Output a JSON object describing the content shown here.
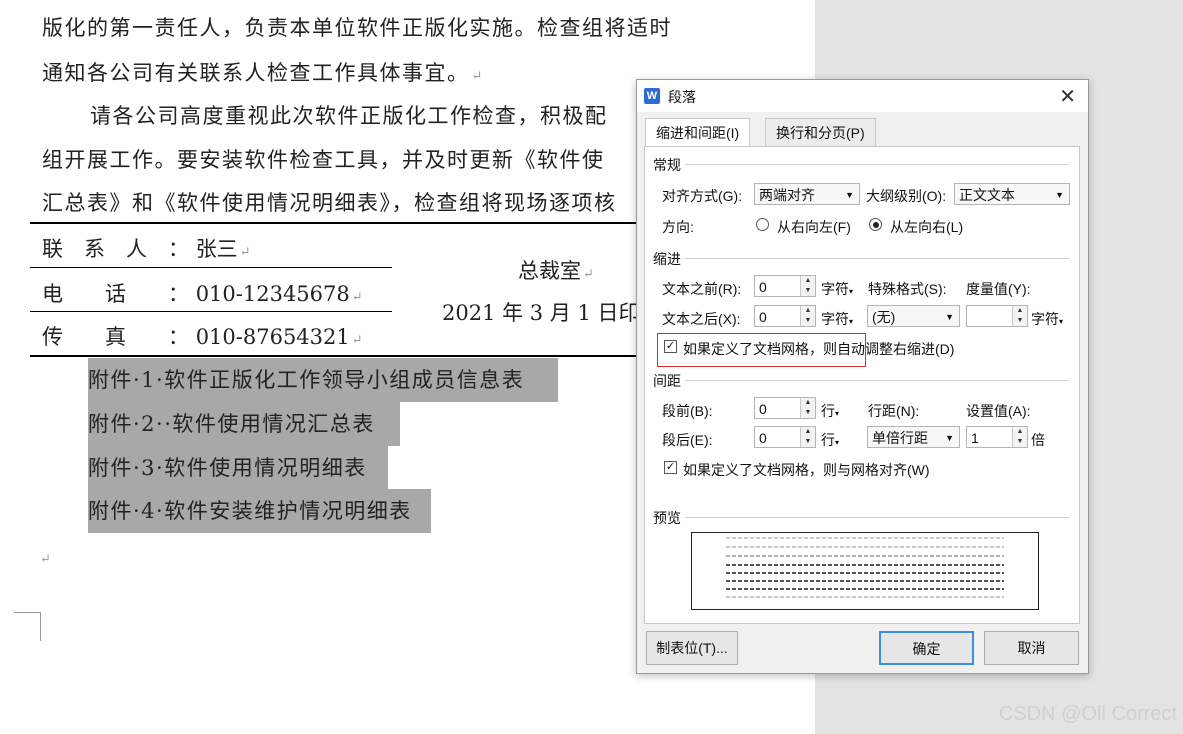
{
  "document": {
    "lines": [
      "版化的第一责任人，负责本单位软件正版化实施。检查组将适时",
      "通知各公司有关联系人检查工作具体事宜。",
      "请各公司高度重视此次软件正版化工作检查，积极配",
      "组开展工作。要安装软件检查工具，并及时更新《软件使",
      "汇总表》和《软件使用情况明细表》，检查组将现场逐项核"
    ],
    "contact": {
      "person_label": "联　系　人　：",
      "person_value": "张三",
      "phone_label": "电　　话　　：",
      "phone_value": "010-12345678",
      "fax_label": "传　　真　　：",
      "fax_value": "010-87654321"
    },
    "issuer": "总裁室",
    "date": "2021 年 3 月 1 日印",
    "attachments": [
      "附件·1·软件正版化工作领导小组成员信息表",
      "附件·2··软件使用情况汇总表",
      "附件·3·软件使用情况明细表",
      "附件·4·软件安装维护情况明细表"
    ],
    "paragraph_mark": "↵"
  },
  "dialog": {
    "title": "段落",
    "app_icon": "W",
    "close_glyph": "✕",
    "tabs": [
      "缩进和间距(I)",
      "换行和分页(P)"
    ],
    "general": {
      "section": "常规",
      "align_label": "对齐方式(G):",
      "align_value": "两端对齐",
      "outline_label": "大纲级别(O):",
      "outline_value": "正文文本",
      "direction_label": "方向:",
      "rtl_label": "从右向左(F)",
      "ltr_label": "从左向右(L)"
    },
    "indent": {
      "section": "缩进",
      "before_label": "文本之前(R):",
      "before_value": "0",
      "before_unit": "字符",
      "after_label": "文本之后(X):",
      "after_value": "0",
      "after_unit": "字符",
      "special_label": "特殊格式(S):",
      "special_value": "(无)",
      "measure_label": "度量值(Y):",
      "measure_value": "",
      "measure_unit": "字符",
      "grid_check": "如果定义了文档网格，则自动调整右缩进(D)"
    },
    "spacing": {
      "section": "间距",
      "before_label": "段前(B):",
      "before_value": "0",
      "before_unit": "行",
      "after_label": "段后(E):",
      "after_value": "0",
      "after_unit": "行",
      "line_label": "行距(N):",
      "line_value": "单倍行距",
      "setting_label": "设置值(A):",
      "setting_value": "1",
      "setting_unit": "倍",
      "grid_check": "如果定义了文档网格，则与网格对齐(W)"
    },
    "preview": {
      "section": "预览"
    },
    "buttons": {
      "tabs": "制表位(T)...",
      "ok": "确定",
      "cancel": "取消"
    }
  },
  "watermark": "CSDN @Oll Correct"
}
